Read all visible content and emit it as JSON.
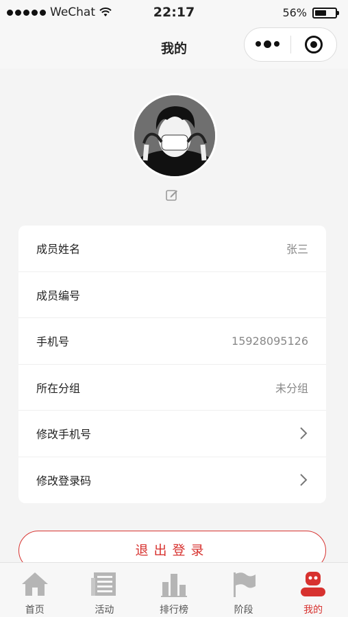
{
  "status_bar": {
    "carrier": "WeChat",
    "time": "22:17",
    "battery_percent": "56%",
    "battery_level": 0.56
  },
  "nav": {
    "title": "我的"
  },
  "profile": {
    "rows": [
      {
        "label": "成员姓名",
        "value": "张三",
        "type": "text"
      },
      {
        "label": "成员编号",
        "value": "",
        "type": "text"
      },
      {
        "label": "手机号",
        "value": "15928095126",
        "type": "text"
      },
      {
        "label": "所在分组",
        "value": "未分组",
        "type": "text"
      },
      {
        "label": "修改手机号",
        "value": "",
        "type": "link"
      },
      {
        "label": "修改登录码",
        "value": "",
        "type": "link"
      }
    ]
  },
  "logout_label": "退出登录",
  "tabs": [
    {
      "label": "首页",
      "icon": "home-icon",
      "active": false
    },
    {
      "label": "活动",
      "icon": "news-icon",
      "active": false
    },
    {
      "label": "排行榜",
      "icon": "ranking-icon",
      "active": false
    },
    {
      "label": "阶段",
      "icon": "flag-icon",
      "active": false
    },
    {
      "label": "我的",
      "icon": "profile-icon",
      "active": true
    }
  ],
  "colors": {
    "accent": "#d7322f",
    "inactive_icon": "#b5b5b5"
  }
}
